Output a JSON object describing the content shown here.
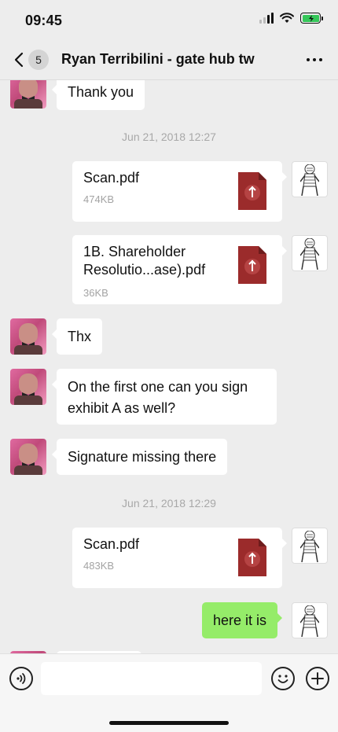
{
  "status_bar": {
    "time": "09:45"
  },
  "nav": {
    "back_count": "5",
    "title": "Ryan Terribilini - gate hub tw"
  },
  "messages": [
    {
      "text": "Thank you"
    },
    {
      "timestamp": "Jun 21, 2018 12:27"
    },
    {
      "file_name": "Scan.pdf",
      "file_size": "474KB"
    },
    {
      "file_name": "1B. Shareholder Resolutio...ase).pdf",
      "file_size": "36KB"
    },
    {
      "text": "Thx"
    },
    {
      "text": "On the first one can you sign exhibit A as well?"
    },
    {
      "text": "Signature missing there"
    },
    {
      "timestamp": "Jun 21, 2018 12:29"
    },
    {
      "file_name": "Scan.pdf",
      "file_size": "483KB"
    },
    {
      "text": "here it is"
    }
  ],
  "input": {
    "placeholder": ""
  },
  "colors": {
    "background": "#ededed",
    "outgoing_bubble": "#95ec69",
    "incoming_bubble": "#ffffff",
    "pdf_red": "#9b2b2b"
  },
  "icons": [
    "back-icon",
    "more-icon",
    "pdf-icon",
    "voice-icon",
    "emoji-icon",
    "plus-icon"
  ]
}
